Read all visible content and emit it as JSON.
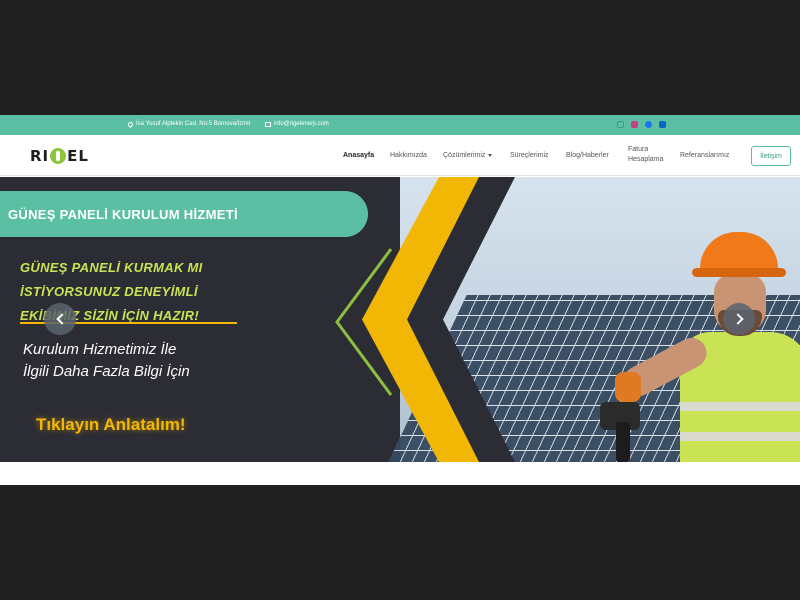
{
  "topbar": {
    "address": "İsa Yusuf Alptekin Cad. No:5 Bornova/İzmir",
    "email": "info@rigelenerji.com",
    "social_icons": [
      "whatsapp-icon",
      "instagram-icon",
      "facebook-icon",
      "linkedin-icon"
    ],
    "color": "#5bbfa4"
  },
  "nav": {
    "logo_left": "RI",
    "logo_right": "EL",
    "items": [
      {
        "label": "Anasayfa",
        "active": true
      },
      {
        "label": "Hakkımızda"
      },
      {
        "label": "Çözümlerimiz",
        "dropdown": true
      },
      {
        "label": "Süreçlerimiz"
      },
      {
        "label": "Blog/Haberler"
      },
      {
        "label": "Fatura Hesaplama"
      },
      {
        "label": "Referanslarımız"
      }
    ],
    "cta": "İletişim"
  },
  "hero": {
    "banner": "GÜNEŞ PANELİ KURULUM HİZMETİ",
    "promo": [
      "GÜNEŞ PANELİ KURMAK MI",
      "İSTİYORSUNUZ DENEYİMLİ",
      "EKİBİMİZ SİZİN İÇİN HAZIR!"
    ],
    "info": [
      "Kurulum Hizmetimiz İle",
      "İlgili Daha Fazla Bilgi İçin"
    ],
    "click": "Tıklayın Anlatalım!",
    "accent_yellow": "#f2b705",
    "accent_green": "#c9e354"
  }
}
